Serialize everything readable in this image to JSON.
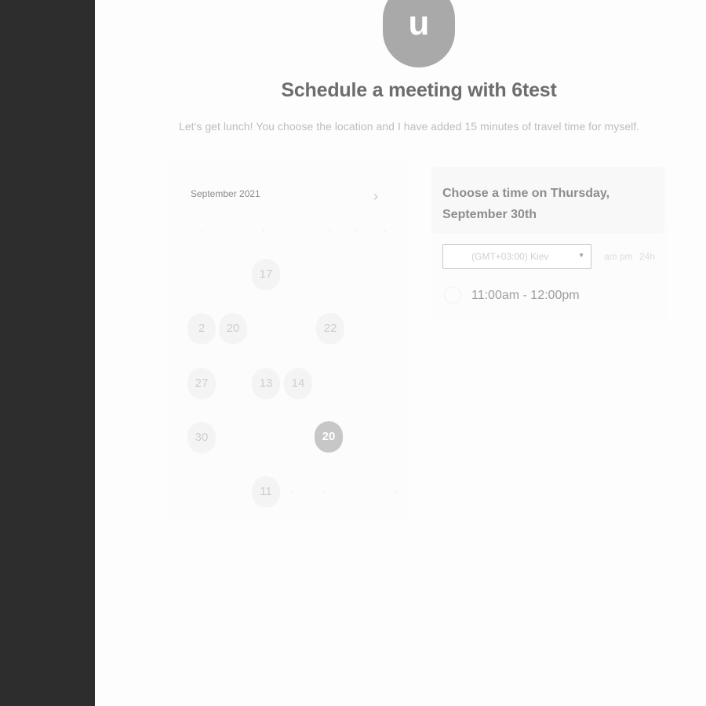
{
  "avatar": {
    "initial": "u"
  },
  "header": {
    "title": "Schedule a meeting with 6test",
    "description": "Let's get lunch! You choose the location and I have added 15 minutes of travel time for myself."
  },
  "calendar": {
    "month_label": "September 2021",
    "next_icon": "chevron-right-icon",
    "weekday_labels": [
      "-",
      "-",
      "-",
      "-",
      "-",
      "-",
      "-"
    ],
    "days": [
      "17",
      "2",
      "20",
      "22",
      "27",
      "13",
      "14",
      "30",
      "20",
      "11"
    ],
    "selected_day": "20",
    "trailing_dashes": [
      "-",
      "-",
      "-"
    ]
  },
  "times": {
    "heading": "Choose a time on Thursday, September 30th",
    "timezone": "(GMT+03:00) Kiev",
    "format_options": [
      "am pm",
      "24h"
    ],
    "slots": [
      "11:00am - 12:00pm"
    ]
  },
  "colors": {
    "sidebar": "#2d2d2d",
    "avatar": "#a9a9a9",
    "selected_day": "#c7c7c7"
  }
}
